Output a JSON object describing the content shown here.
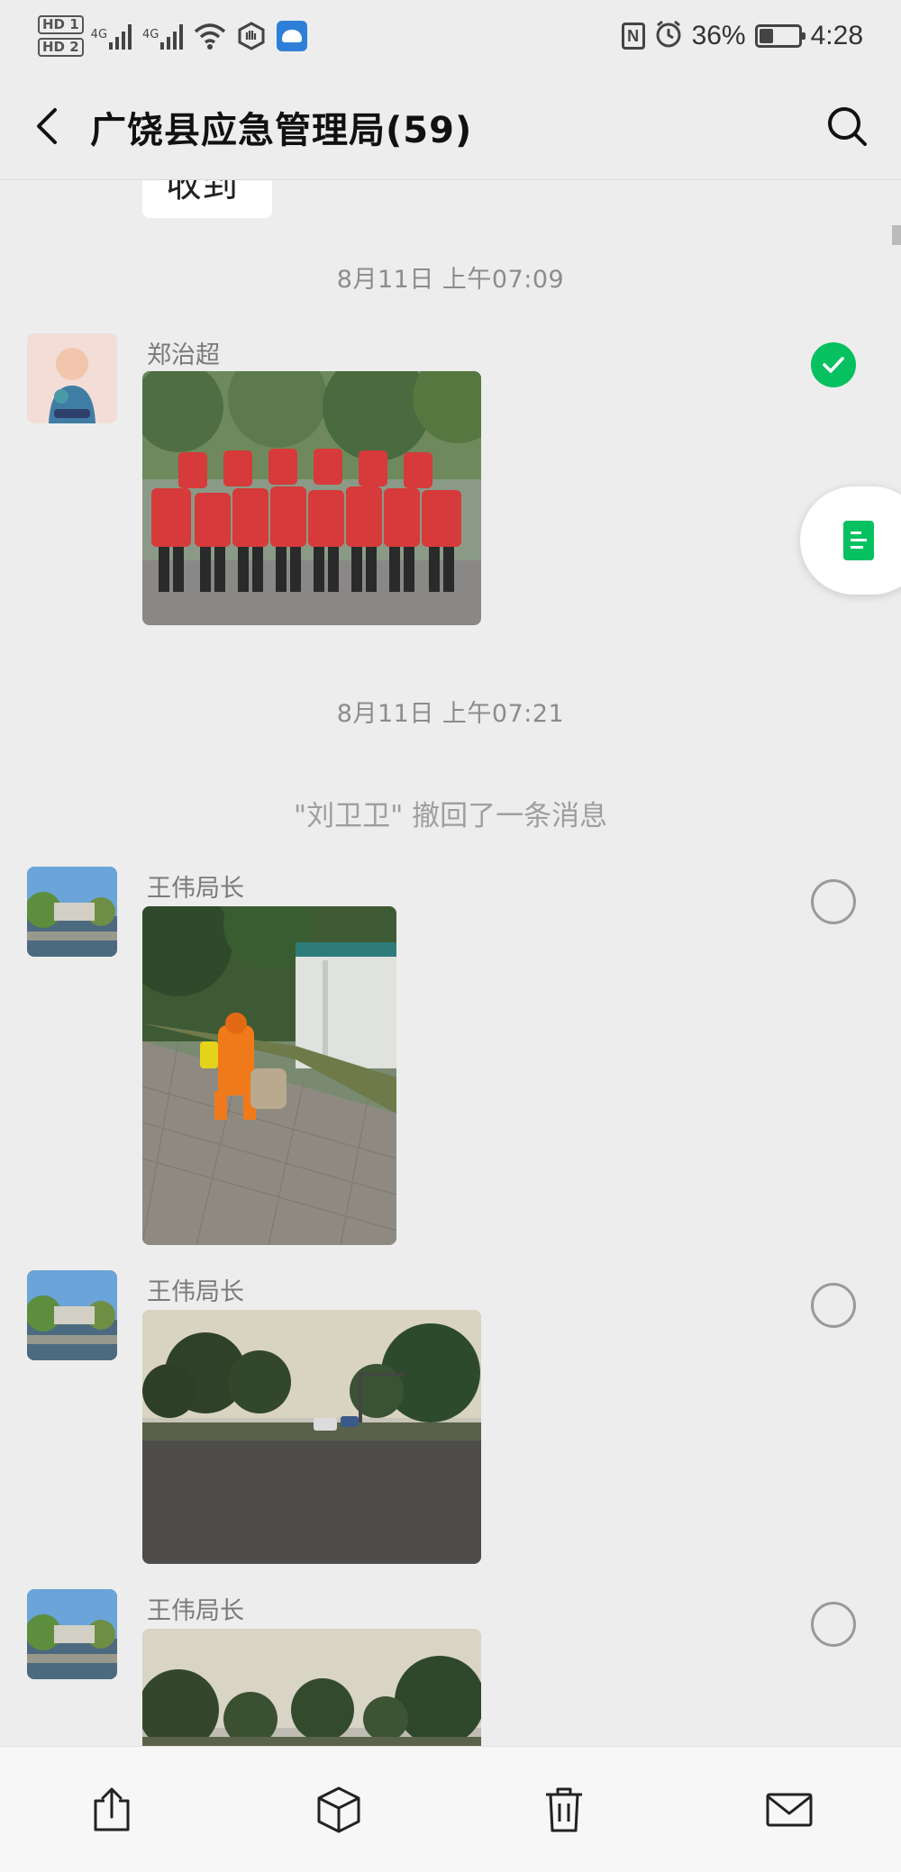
{
  "status_bar": {
    "hd_labels": [
      "HD 1",
      "HD 2"
    ],
    "network_labels": [
      "4G",
      "4G"
    ],
    "battery": "36%",
    "battery_level": 0.36,
    "time": "4:28",
    "icons": [
      "hd-icon",
      "signal-icon",
      "wifi-icon",
      "hand-icon",
      "app-icon",
      "nfc-icon",
      "alarm-icon",
      "battery-icon"
    ]
  },
  "header": {
    "title": "广饶县应急管理局(59)",
    "icons": [
      "back-arrow-icon",
      "search-icon"
    ]
  },
  "chat": {
    "partial_message": "收到",
    "time_1": "8月11日 上午07:09",
    "time_2": "8月11日 上午07:21",
    "recall_notice": "\"刘卫卫\" 撤回了一条消息",
    "messages": [
      {
        "sender": "郑治超",
        "type": "image",
        "content": "group-photo",
        "selected": true
      },
      {
        "sender": "王伟局长",
        "type": "image",
        "content": "street-sweeper-photo",
        "selected": false
      },
      {
        "sender": "王伟局长",
        "type": "image",
        "content": "road-photo",
        "selected": false
      },
      {
        "sender": "王伟局长",
        "type": "image",
        "content": "road-photo-2",
        "selected": false
      }
    ]
  },
  "floating_action": {
    "icon": "document-icon"
  },
  "bottom_toolbar": {
    "icons": [
      "share-icon",
      "box-icon",
      "trash-icon",
      "mail-icon"
    ]
  },
  "colors": {
    "background": "#ededed",
    "accent_green": "#07c160",
    "bubble": "#ffffff"
  }
}
